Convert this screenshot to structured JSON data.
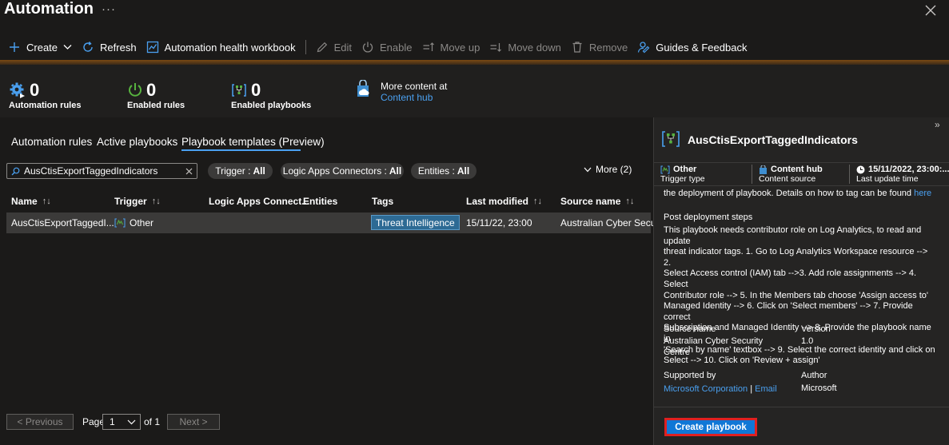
{
  "header": {
    "title": "Automation",
    "ellipsis": "···"
  },
  "toolbar": {
    "create": "Create",
    "refresh": "Refresh",
    "workbook": "Automation health workbook",
    "edit": "Edit",
    "enable": "Enable",
    "move_up": "Move up",
    "move_down": "Move down",
    "remove": "Remove",
    "guides": "Guides & Feedback"
  },
  "stats": {
    "automation_rules": {
      "value": "0",
      "label": "Automation rules"
    },
    "enabled_rules": {
      "value": "0",
      "label": "Enabled rules"
    },
    "enabled_playbooks": {
      "value": "0",
      "label": "Enabled playbooks"
    },
    "content_hub": {
      "text": "More content at",
      "link": "Content hub"
    }
  },
  "tabs": [
    {
      "label": "Automation rules"
    },
    {
      "label": "Active playbooks"
    },
    {
      "label": "Playbook templates (Preview)"
    }
  ],
  "filters": {
    "search_value": "AusCtisExportTaggedIndicators",
    "trigger": {
      "label": "Trigger :",
      "value": "All"
    },
    "connectors": {
      "label": "Logic Apps Connectors :",
      "value": "All"
    },
    "entities": {
      "label": "Entities :",
      "value": "All"
    },
    "more": "More (2)"
  },
  "table": {
    "headers": [
      "Name",
      "Trigger",
      "Logic Apps Connect...",
      "Entities",
      "Tags",
      "Last modified",
      "Source name"
    ],
    "sort_glyph": "↑↓",
    "rows": [
      {
        "name": "AusCtisExportTaggedI...",
        "trigger": "Other",
        "tag": "Threat Intelligence",
        "last_modified": "15/11/22, 23:00",
        "source": "Australian Cyber Secur..."
      }
    ]
  },
  "pagination": {
    "previous": "< Previous",
    "page_label": "Page",
    "page_value": "1",
    "of_label": "of 1",
    "next": "Next >"
  },
  "panel": {
    "title": "AusCtisExportTaggedIndicators",
    "trigger": {
      "value": "Other",
      "label": "Trigger type"
    },
    "source": {
      "value": "Content hub",
      "label": "Content source"
    },
    "updated": {
      "value": "15/11/2022, 23:00:...",
      "label": "Last update time"
    },
    "top_text": "the deployment of playbook. Details on how to tag can be found",
    "top_link": "here",
    "post_heading": "Post deployment steps",
    "post_lines": [
      "This playbook needs contributor role on Log Analytics, to read and update",
      "threat indicator tags. 1. Go to Log Analytics Workspace resource --> 2.",
      "Select Access control (IAM) tab -->3. Add role assignments --> 4. Select",
      "Contributor role --> 5. In the Members tab choose 'Assign access to'",
      "Managed Identity --> 6. Click on 'Select members' --> 7. Provide correct",
      "Subscription and Managed Identity --> 8. Provide the playbook name in",
      "'Search by name' textbox --> 9. Select the correct identity and click on",
      "Select --> 10. Click on 'Review + assign'"
    ],
    "source_name_label": "Source name",
    "source_name_value": [
      "Australian Cyber Security",
      "Centre"
    ],
    "version_label": "Version",
    "version_value": "1.0",
    "supported_by_label": "Supported by",
    "supported_by_link": "Microsoft Corporation",
    "supported_sep": "|",
    "email_link": "Email",
    "author_label": "Author",
    "author_value": "Microsoft",
    "create_button": "Create playbook",
    "collapse_glyph": "»"
  }
}
